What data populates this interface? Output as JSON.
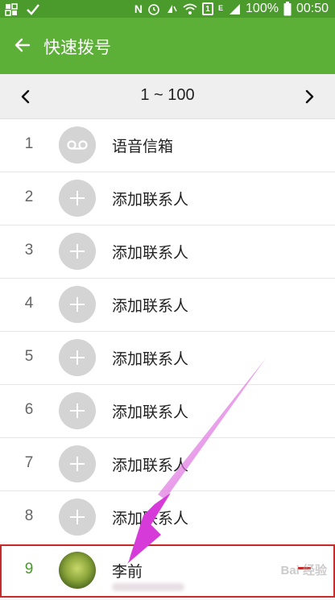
{
  "status_bar": {
    "carrier_icon": "N",
    "sim_label": "1",
    "network_label": "E",
    "battery": "100%",
    "time": "00:50"
  },
  "app_bar": {
    "title": "快速拨号",
    "back_icon": "arrow-left-icon"
  },
  "range": {
    "label": "1 ~ 100",
    "prev_icon": "chevron-left-icon",
    "next_icon": "chevron-right-icon"
  },
  "rows": [
    {
      "num": "1",
      "label": "语音信箱",
      "icon": "voicemail-icon"
    },
    {
      "num": "2",
      "label": "添加联系人",
      "icon": "plus-icon"
    },
    {
      "num": "3",
      "label": "添加联系人",
      "icon": "plus-icon"
    },
    {
      "num": "4",
      "label": "添加联系人",
      "icon": "plus-icon"
    },
    {
      "num": "5",
      "label": "添加联系人",
      "icon": "plus-icon"
    },
    {
      "num": "6",
      "label": "添加联系人",
      "icon": "plus-icon"
    },
    {
      "num": "7",
      "label": "添加联系人",
      "icon": "plus-icon"
    },
    {
      "num": "8",
      "label": "添加联系人",
      "icon": "plus-icon"
    },
    {
      "num": "9",
      "label": "李前",
      "icon": "contact-photo"
    }
  ],
  "colors": {
    "status_bar": "#4a9a2c",
    "app_bar": "#5cb037",
    "accent": "#4a9a2c",
    "highlight_border": "#c62c2c",
    "annotation_arrow": "#d63ad8"
  },
  "watermark": "Bai 经验"
}
